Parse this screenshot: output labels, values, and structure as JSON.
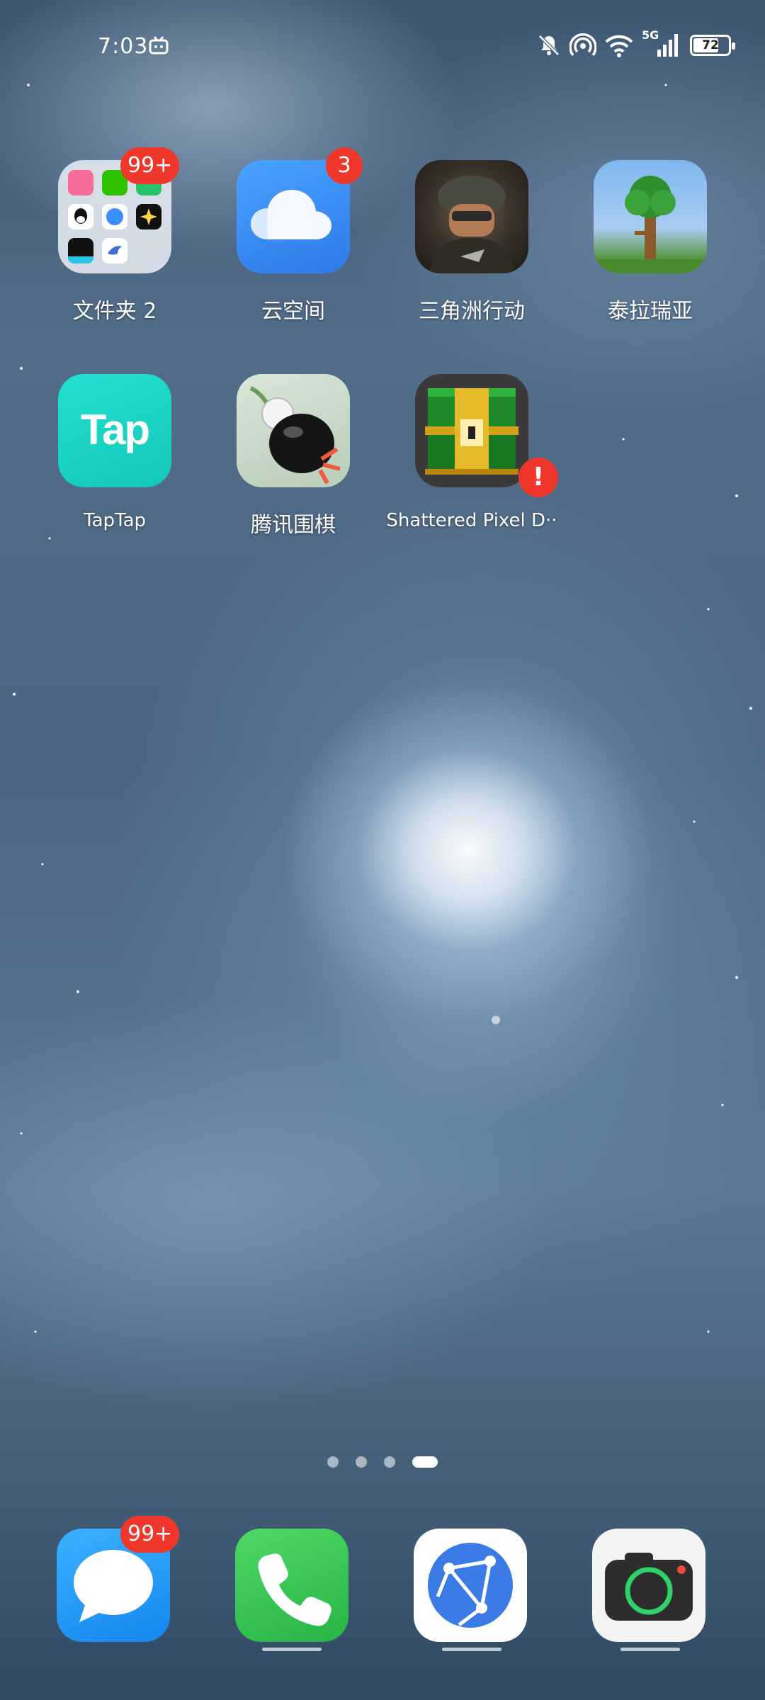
{
  "status_bar": {
    "time": "7:03",
    "network": "5G",
    "battery": "72",
    "battery_level": 0.72,
    "icons": [
      "tv-icon",
      "bell-muted-icon",
      "hotspot-icon",
      "wifi-icon",
      "cellular-signal-icon",
      "battery-icon"
    ]
  },
  "apps": [
    {
      "label": "文件夹 2",
      "badge": "99+",
      "icon": "folder-icon"
    },
    {
      "label": "云空间",
      "badge": "3",
      "icon": "cloud-icon"
    },
    {
      "label": "三角洲行动",
      "badge": "",
      "icon": "soldier-game-icon"
    },
    {
      "label": "泰拉瑞亚",
      "badge": "",
      "icon": "tree-game-icon"
    },
    {
      "label": "TapTap",
      "badge": "",
      "icon": "taptap-icon",
      "icon_text": "Tap"
    },
    {
      "label": "腾讯围棋",
      "badge": "",
      "icon": "go-stone-icon"
    },
    {
      "label": "Shattered Pixel D··",
      "badge": "!",
      "icon": "treasure-chest-icon"
    }
  ],
  "folder_apps": [
    "bilibili-icon",
    "wechat-icon",
    "message-icon",
    "qq-icon",
    "chat-bubble-icon",
    "sparkle-icon",
    "bookstore-icon",
    "bird-icon"
  ],
  "page_indicator": {
    "pages": 4,
    "current": 4
  },
  "dock": [
    {
      "name": "messages",
      "badge": "99+",
      "icon": "chat-icon"
    },
    {
      "name": "phone",
      "badge": "",
      "icon": "phone-icon"
    },
    {
      "name": "browser",
      "badge": "",
      "icon": "browser-icon"
    },
    {
      "name": "camera",
      "badge": "",
      "icon": "camera-icon"
    }
  ],
  "colors": {
    "badge": "#f0372c",
    "cloud_app": "#3b8cf7",
    "taptap": "#17d5c3",
    "phone": "#35c759",
    "messages": "#1e9bf5",
    "browser": "#3a7be6"
  }
}
